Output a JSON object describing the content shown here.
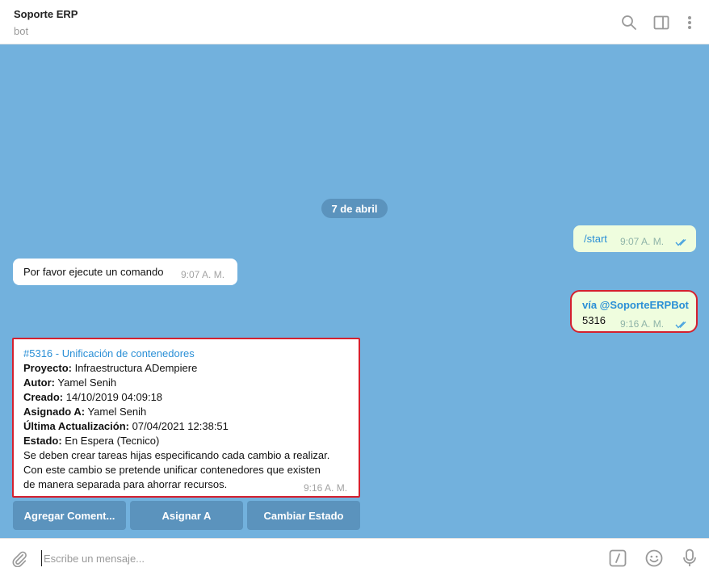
{
  "header": {
    "title": "Soporte ERP",
    "subtitle": "bot",
    "icons": [
      "search-icon",
      "sidebar-toggle-icon",
      "more-vertical-icon"
    ]
  },
  "chat": {
    "date_separator": "7 de abril",
    "messages": [
      {
        "direction": "out",
        "text": "/start",
        "time": "9:07 A. M.",
        "status": "read"
      },
      {
        "direction": "in",
        "text": "Por favor ejecute un comando",
        "time": "9:07 A. M."
      },
      {
        "direction": "out",
        "via": "vía @SoporteERPBot",
        "text": "5316",
        "time": "9:16 A. M.",
        "status": "read"
      },
      {
        "direction": "in",
        "ticket": {
          "link": "#5316 - Unificación de contenedores",
          "fields": [
            {
              "label": "Proyecto:",
              "value": "Infraestructura ADempiere"
            },
            {
              "label": "Autor:",
              "value": "Yamel Senih"
            },
            {
              "label": "Creado:",
              "value": "14/10/2019 04:09:18"
            },
            {
              "label": "Asignado A:",
              "value": "Yamel Senih"
            },
            {
              "label": "Última Actualización:",
              "value": "07/04/2021 12:38:51"
            },
            {
              "label": "Estado:",
              "value": "En Espera (Tecnico)"
            }
          ],
          "description": [
            "Se deben crear tareas hijas especificando cada cambio a realizar.",
            "Con este cambio se pretende unificar contenedores que existen",
            "de manera separada para ahorrar recursos."
          ]
        },
        "time": "9:16 A. M."
      }
    ],
    "inline_keyboard": [
      "Agregar Coment...",
      "Asignar A",
      "Cambiar Estado"
    ]
  },
  "composer": {
    "placeholder": "Escribe un mensaje...",
    "icons": [
      "attach-icon",
      "bot-commands-icon",
      "emoji-icon",
      "microphone-icon"
    ]
  },
  "colors": {
    "chat_background": "#72b1dd",
    "link": "#2a8fd6",
    "keyboard_button": "#5b93bd",
    "highlight_border": "#d4202f"
  }
}
